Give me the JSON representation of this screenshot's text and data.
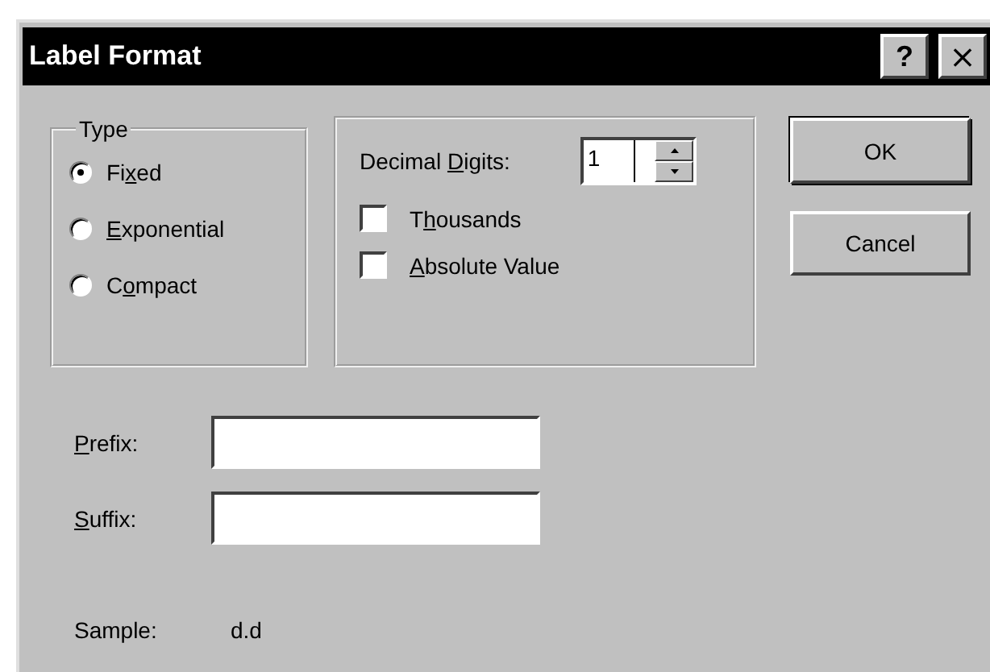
{
  "window": {
    "title": "Label Format",
    "controls": [
      {
        "kind": "help",
        "label": "?"
      },
      {
        "kind": "close",
        "label": "×"
      }
    ]
  },
  "type_group": {
    "title": "Type",
    "options": [
      {
        "label": {
          "before": "Fi",
          "key": "x",
          "after": "ed"
        },
        "selected": true
      },
      {
        "label": {
          "key": "E",
          "after": "xponential"
        },
        "selected": false
      },
      {
        "label": {
          "before": "C",
          "key": "o",
          "after": "mpact"
        },
        "selected": false
      }
    ]
  },
  "number_group": {
    "decimal_digits": {
      "label": {
        "before": "Decimal ",
        "key": "D",
        "after": "igits:"
      },
      "value": "1"
    },
    "checkboxes": [
      {
        "label": {
          "before": "T",
          "key": "h",
          "after": "ousands"
        },
        "checked": false
      },
      {
        "label": {
          "key": "A",
          "after": "bsolute Value"
        },
        "checked": false
      }
    ]
  },
  "buttons": [
    {
      "label": "OK",
      "default": true
    },
    {
      "label": "Cancel",
      "default": false
    }
  ],
  "fields": [
    {
      "label": {
        "key": "P",
        "after": "refix:"
      }
    },
    {
      "label": {
        "key": "S",
        "after": "uffix:"
      }
    }
  ],
  "sample": {
    "label": "Sample:",
    "value": "d.d"
  }
}
